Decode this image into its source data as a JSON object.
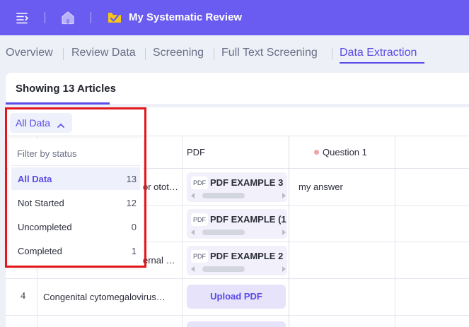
{
  "header": {
    "project_title": "My Systematic Review",
    "bar_color": "#6a5cf0",
    "icons": [
      "menu-collapse-icon",
      "home-icon",
      "project-icon"
    ]
  },
  "tabs": [
    {
      "label": "Overview",
      "active": false
    },
    {
      "label": "Review Data",
      "active": false
    },
    {
      "label": "Screening",
      "active": false
    },
    {
      "label": "Full Text Screening",
      "active": false
    },
    {
      "label": "Data Extraction",
      "active": true
    }
  ],
  "summary": {
    "showing_label": "Showing 13 Articles"
  },
  "filter": {
    "button_label": "All Data",
    "heading": "Filter by status",
    "options": [
      {
        "label": "All Data",
        "count": "13",
        "selected": true
      },
      {
        "label": "Not Started",
        "count": "12",
        "selected": false
      },
      {
        "label": "Uncompleted",
        "count": "0",
        "selected": false
      },
      {
        "label": "Completed",
        "count": "1",
        "selected": false
      }
    ]
  },
  "table": {
    "columns": {
      "pdf": "PDF",
      "question": "Question 1"
    },
    "rows": [
      {
        "title_fragment": "or otot…",
        "pdf": "PDF EXAMPLE 3",
        "answer": "my answer"
      },
      {
        "title_fragment": "",
        "pdf": "PDF EXAMPLE (1",
        "answer": ""
      },
      {
        "title_fragment": "ernal …",
        "pdf": "PDF EXAMPLE 2",
        "answer": ""
      },
      {
        "number": "4",
        "title": "Congenital cytomegalovirus…",
        "upload_label": "Upload PDF"
      }
    ],
    "pdf_badge": "PDF"
  },
  "colors": {
    "accent": "#5a4be8",
    "highlight": "#e3161b",
    "status_dot": "#f2a3a3"
  }
}
